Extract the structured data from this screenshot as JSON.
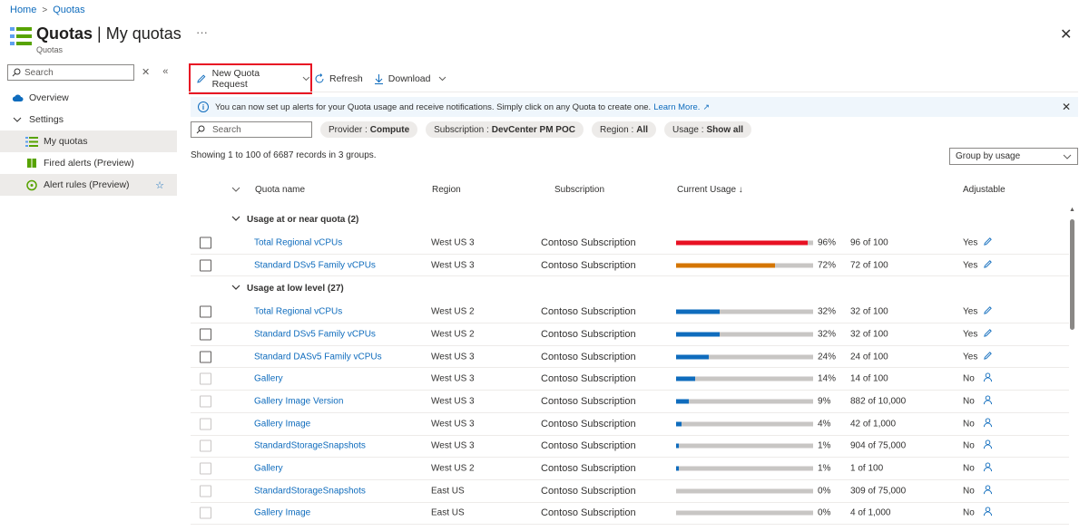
{
  "breadcrumb": {
    "home": "Home",
    "current": "Quotas"
  },
  "header": {
    "title_bold": "Quotas",
    "title_rest": " | My quotas",
    "subtitle": "Quotas",
    "more": "···"
  },
  "sidebar": {
    "search_placeholder": "Search",
    "items": [
      {
        "label": "Overview",
        "icon": "cloud-icon"
      },
      {
        "label": "Settings",
        "icon": "chevron-down-icon"
      },
      {
        "label": "My quotas",
        "icon": "list-icon",
        "active": true
      },
      {
        "label": "Fired alerts (Preview)",
        "icon": "book-icon"
      },
      {
        "label": "Alert rules (Preview)",
        "icon": "alert-rule-icon",
        "star": "☆"
      }
    ]
  },
  "toolbar": {
    "new_request": "New Quota Request",
    "refresh": "Refresh",
    "download": "Download"
  },
  "banner": {
    "text": "You can now set up alerts for your Quota usage and receive notifications. Simply click on any Quota to create one.",
    "link": "Learn More."
  },
  "filters": {
    "search_placeholder": "Search",
    "pills": [
      {
        "key": "Provider :",
        "value": "Compute"
      },
      {
        "key": "Subscription :",
        "value": "DevCenter PM POC"
      },
      {
        "key": "Region :",
        "value": "All"
      },
      {
        "key": "Usage :",
        "value": "Show all"
      }
    ]
  },
  "records": "Showing 1 to 100 of 6687 records in 3 groups.",
  "group_by": "Group by usage",
  "columns": {
    "name": "Quota name",
    "region": "Region",
    "subscription": "Subscription",
    "usage": "Current Usage ↓",
    "adjustable": "Adjustable"
  },
  "colors": {
    "red": "#e81123",
    "orange": "#d47500",
    "blue": "#0f6cbd",
    "link": "#0f6cbd"
  },
  "groups": [
    {
      "label": "Usage at or near quota (2)",
      "rows": [
        {
          "name": "Total Regional vCPUs",
          "region": "West US 3",
          "subscription": "Contoso Subscription",
          "pct": 96,
          "pct_label": "96%",
          "usage": "96 of 100",
          "adjustable": "Yes",
          "color": "#e81123",
          "icon": "edit-icon",
          "disabled": false
        },
        {
          "name": "Standard DSv5 Family vCPUs",
          "region": "West US 3",
          "subscription": "Contoso Subscription",
          "pct": 72,
          "pct_label": "72%",
          "usage": "72 of 100",
          "adjustable": "Yes",
          "color": "#d47500",
          "icon": "edit-icon",
          "disabled": false
        }
      ]
    },
    {
      "label": "Usage at low level (27)",
      "rows": [
        {
          "name": "Total Regional vCPUs",
          "region": "West US 2",
          "subscription": "Contoso Subscription",
          "pct": 32,
          "pct_label": "32%",
          "usage": "32 of 100",
          "adjustable": "Yes",
          "color": "#0f6cbd",
          "icon": "edit-icon",
          "disabled": false
        },
        {
          "name": "Standard DSv5 Family vCPUs",
          "region": "West US 2",
          "subscription": "Contoso Subscription",
          "pct": 32,
          "pct_label": "32%",
          "usage": "32 of 100",
          "adjustable": "Yes",
          "color": "#0f6cbd",
          "icon": "edit-icon",
          "disabled": false
        },
        {
          "name": "Standard DASv5 Family vCPUs",
          "region": "West US 3",
          "subscription": "Contoso Subscription",
          "pct": 24,
          "pct_label": "24%",
          "usage": "24 of 100",
          "adjustable": "Yes",
          "color": "#0f6cbd",
          "icon": "edit-icon",
          "disabled": false
        },
        {
          "name": "Gallery",
          "region": "West US 3",
          "subscription": "Contoso Subscription",
          "pct": 14,
          "pct_label": "14%",
          "usage": "14 of 100",
          "adjustable": "No",
          "color": "#0f6cbd",
          "icon": "person-icon",
          "disabled": true
        },
        {
          "name": "Gallery Image Version",
          "region": "West US 3",
          "subscription": "Contoso Subscription",
          "pct": 9,
          "pct_label": "9%",
          "usage": "882 of 10,000",
          "adjustable": "No",
          "color": "#0f6cbd",
          "icon": "person-icon",
          "disabled": true
        },
        {
          "name": "Gallery Image",
          "region": "West US 3",
          "subscription": "Contoso Subscription",
          "pct": 4,
          "pct_label": "4%",
          "usage": "42 of 1,000",
          "adjustable": "No",
          "color": "#0f6cbd",
          "icon": "person-icon",
          "disabled": true
        },
        {
          "name": "StandardStorageSnapshots",
          "region": "West US 3",
          "subscription": "Contoso Subscription",
          "pct": 1,
          "pct_label": "1%",
          "usage": "904 of 75,000",
          "adjustable": "No",
          "color": "#0f6cbd",
          "icon": "person-icon",
          "disabled": true
        },
        {
          "name": "Gallery",
          "region": "West US 2",
          "subscription": "Contoso Subscription",
          "pct": 1,
          "pct_label": "1%",
          "usage": "1 of 100",
          "adjustable": "No",
          "color": "#0f6cbd",
          "icon": "person-icon",
          "disabled": true
        },
        {
          "name": "StandardStorageSnapshots",
          "region": "East US",
          "subscription": "Contoso Subscription",
          "pct": 0,
          "pct_label": "0%",
          "usage": "309 of 75,000",
          "adjustable": "No",
          "color": "#0f6cbd",
          "icon": "person-icon",
          "disabled": true
        },
        {
          "name": "Gallery Image",
          "region": "East US",
          "subscription": "Contoso Subscription",
          "pct": 0,
          "pct_label": "0%",
          "usage": "4 of 1,000",
          "adjustable": "No",
          "color": "#0f6cbd",
          "icon": "person-icon",
          "disabled": true
        }
      ]
    }
  ]
}
